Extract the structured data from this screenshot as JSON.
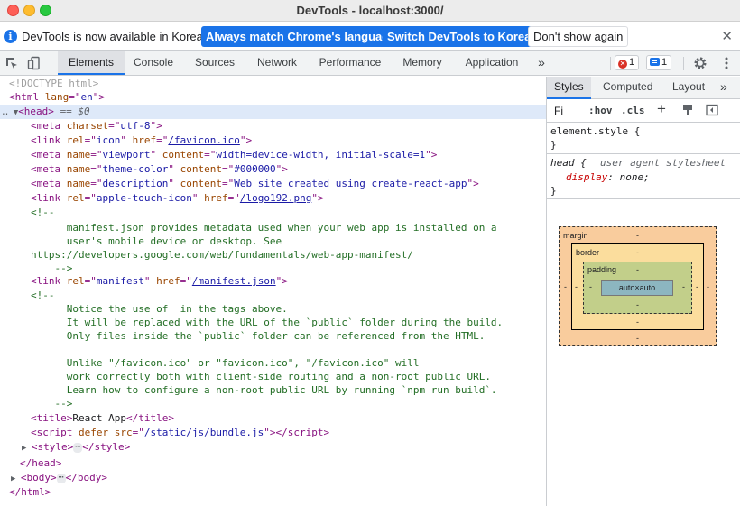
{
  "window": {
    "title": "DevTools - localhost:3000/"
  },
  "infobar": {
    "message": "DevTools is now available in Korean!",
    "btn_match": "Always match Chrome's language",
    "btn_switch": "Switch DevTools to Korean",
    "btn_dont_show": "Don't show again",
    "close_glyph": "✕"
  },
  "tabs": {
    "items": [
      "Elements",
      "Console",
      "Sources",
      "Network",
      "Performance",
      "Memory",
      "Application"
    ],
    "active": "Elements",
    "overflow": "»",
    "error_count": "1",
    "message_count": "1"
  },
  "dom": {
    "doctype": "<!DOCTYPE html>",
    "head_selected_suffix": "== $0",
    "comment1": [
      "<!--",
      "      manifest.json provides metadata used when your web app is installed on a",
      "      user's mobile device or desktop. See",
      "https://developers.google.com/web/fundamentals/web-app-manifest/",
      "    -->"
    ],
    "comment2": [
      "<!--",
      "      Notice the use of  in the tags above.",
      "      It will be replaced with the URL of the `public` folder during the build.",
      "      Only files inside the `public` folder can be referenced from the HTML.",
      "",
      "      Unlike \"/favicon.ico\" or \"favicon.ico\", \"/favicon.ico\" will",
      "      work correctly both with client-side routing and a non-root public URL.",
      "      Learn how to configure a non-root public URL by running `npm run build`.",
      "    -->"
    ],
    "title_text": "React App",
    "ellipsis": "⋯",
    "attrs": {
      "lang": "en",
      "charset": "utf-8",
      "icon_rel": "icon",
      "icon_href": "/favicon.ico",
      "viewport_name": "viewport",
      "viewport_content": "width=device-width, initial-scale=1",
      "theme_name": "theme-color",
      "theme_content": "#000000",
      "desc_name": "description",
      "desc_content": "Web site created using create-react-app",
      "apple_rel": "apple-touch-icon",
      "apple_href": "/logo192.png",
      "manifest_rel": "manifest",
      "manifest_href": "/manifest.json",
      "script_src": "/static/js/bundle.js"
    }
  },
  "styles": {
    "tabs": [
      "Styles",
      "Computed",
      "Layout"
    ],
    "active": "Styles",
    "overflow": "»",
    "filter_placeholder": "Fi",
    "hov": ":hov",
    "cls": ".cls",
    "add": "+",
    "rule1_selector": "element.style {",
    "rule1_close": "}",
    "rule2_selector": "head {",
    "rule2_source": "user agent stylesheet",
    "rule2_prop": "display",
    "rule2_value": "none;",
    "rule2_close": "}"
  },
  "box_model": {
    "margin_label": "margin",
    "border_label": "border",
    "padding_label": "padding",
    "content": "auto×auto",
    "dash": "-"
  },
  "colors": {
    "accent": "#1a73e8",
    "selected_row": "#dee9f9",
    "tag": "#881280",
    "attr_name": "#994500",
    "attr_value": "#1a1aa6",
    "comment": "#236e25"
  }
}
